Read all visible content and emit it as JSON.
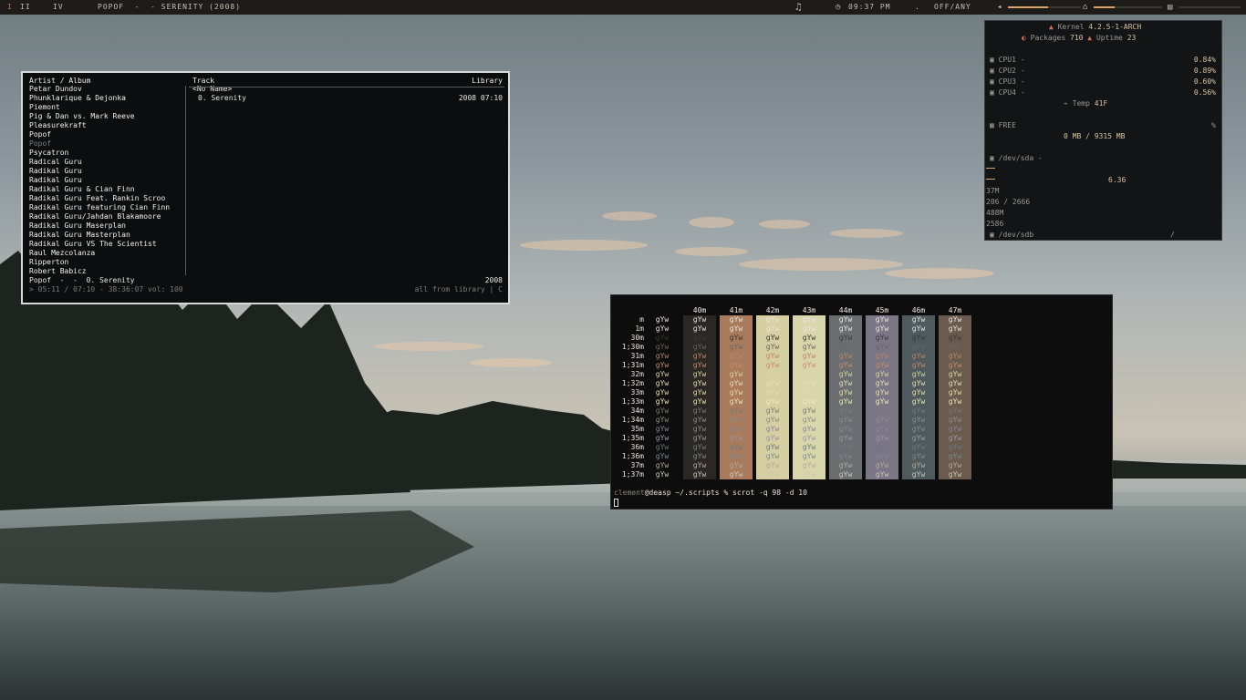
{
  "topbar": {
    "workspaces": [
      "I",
      "II",
      "IV"
    ],
    "now_playing": "POPOF  -  - SERENITY (2008)",
    "music_icon": "music-note-icon",
    "clock_icon": "clock-icon",
    "time": "09:37 PM",
    "network": "OFF/ANY",
    "volume_icon": "speaker-icon",
    "volume_level": 0.55,
    "brightness_level": 0.3
  },
  "cmus": {
    "header_artist": "Artist / Album",
    "header_track": "Track",
    "header_library": "Library",
    "artists": [
      "Petar Dundov",
      "Phunklarique & Dejonka",
      "Piemont",
      "Pig & Dan vs. Mark Reeve",
      "Pleasurekraft",
      "Popof",
      "Popof",
      "Psycatron",
      "Radical Guru",
      "Radikal Guru",
      "Radikal Guru",
      "Radikal Guru & Cian Finn",
      "Radikal Guru Feat. Rankin Scroo",
      "Radikal Guru featuring Cian Finn",
      "Radikal Guru/Jahdan Blakamoore",
      "Radikal Guru Maserplan",
      "Radikal Guru Masterplan",
      "Radikal Guru VS The Scientist",
      "Raul Mezcolanza",
      "Ripperton",
      "Robert Babicz"
    ],
    "selected_index": 6,
    "album_group": "<No Name>",
    "track": "0. Serenity",
    "track_meta": "2008 07:10",
    "status_left": "Popof  -  -  0. Serenity",
    "status_year": "2008",
    "progress": "> 05:11 / 07:10 - 38:36:07 vol: 100",
    "filter": "all from library | C"
  },
  "sysmon": {
    "kernel_label": "Kernel",
    "kernel": "4.2.5-1-ARCH",
    "packages_label": "Packages",
    "packages": "710",
    "uptime_label": "Uptime",
    "uptime": "23",
    "cpus": [
      {
        "label": "CPU1 -",
        "value": "0.84%"
      },
      {
        "label": "CPU2 -",
        "value": "0.89%"
      },
      {
        "label": "CPU3 -",
        "value": "0.60%"
      },
      {
        "label": "CPU4 -",
        "value": "0.56%"
      }
    ],
    "temp_label": "Temp",
    "temp": "41F",
    "free_label": "FREE",
    "free_pct": "%",
    "mem": "0 MB / 9315 MB",
    "sda_label": "/dev/sda -",
    "sda_value": "6.36",
    "sda_small": "37M",
    "sda_usage": "206 / 2666",
    "sdb_a": "488M",
    "sdb_b": "2586",
    "sdb_label": "/dev/sdb",
    "sdb_mount": "/"
  },
  "terminal": {
    "column_headers": [
      "40m",
      "41m",
      "42m",
      "43m",
      "44m",
      "45m",
      "46m",
      "47m"
    ],
    "row_labels": [
      "m",
      "1m",
      "30m",
      "1;30m",
      "31m",
      "1;31m",
      "32m",
      "1;32m",
      "33m",
      "1;33m",
      "34m",
      "1;34m",
      "35m",
      "1;35m",
      "36m",
      "1;36m",
      "37m",
      "1;37m"
    ],
    "sample": "gYw",
    "bg_colors": [
      "#2a2724",
      "#a97a5c",
      "#d6cfa2",
      "#dad6ac",
      "#6b6e70",
      "#7a7686",
      "#4f5a5e",
      "#6a5b4e"
    ],
    "fg_colors": [
      "#e8e4da",
      "#e8e4da",
      "#3a3834",
      "#6b6660",
      "#b8866a",
      "#c88a68",
      "#d9d49e",
      "#e4dfb0",
      "#e7d9a4",
      "#f0e6b2",
      "#7a7a76",
      "#8c8c86",
      "#8a8496",
      "#9a94a6",
      "#6c7a7e",
      "#7c8a8e",
      "#b6a898",
      "#cfc4b6"
    ],
    "prompt_user": "clement",
    "prompt_rest": "@deasp ~/.scripts % scrot -q 98 -d 10"
  }
}
